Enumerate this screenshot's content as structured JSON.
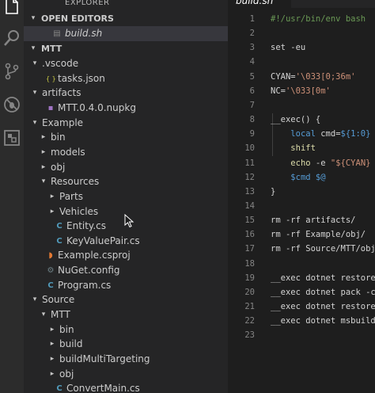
{
  "explorer": {
    "title": "EXPLORER",
    "open_editors_label": "OPEN EDITORS",
    "open_file": "build.sh",
    "root_label": "MTT",
    "tree": [
      {
        "label": ".vscode",
        "depth": 1,
        "open": true,
        "type": "folder"
      },
      {
        "label": "tasks.json",
        "depth": 2,
        "type": "json"
      },
      {
        "label": "artifacts",
        "depth": 1,
        "open": true,
        "type": "folder"
      },
      {
        "label": "MTT.0.4.0.nupkg",
        "depth": 2,
        "type": "file"
      },
      {
        "label": "Example",
        "depth": 1,
        "open": true,
        "type": "folder"
      },
      {
        "label": "bin",
        "depth": 2,
        "open": false,
        "type": "folder"
      },
      {
        "label": "models",
        "depth": 2,
        "open": false,
        "type": "folder"
      },
      {
        "label": "obj",
        "depth": 2,
        "open": false,
        "type": "folder"
      },
      {
        "label": "Resources",
        "depth": 2,
        "open": true,
        "type": "folder"
      },
      {
        "label": "Parts",
        "depth": 3,
        "open": false,
        "type": "folder"
      },
      {
        "label": "Vehicles",
        "depth": 3,
        "open": false,
        "type": "folder"
      },
      {
        "label": "Entity.cs",
        "depth": 3,
        "type": "cs"
      },
      {
        "label": "KeyValuePair.cs",
        "depth": 3,
        "type": "cs"
      },
      {
        "label": "Example.csproj",
        "depth": 2,
        "type": "rss"
      },
      {
        "label": "NuGet.config",
        "depth": 2,
        "type": "gear"
      },
      {
        "label": "Program.cs",
        "depth": 2,
        "type": "cs"
      },
      {
        "label": "Source",
        "depth": 1,
        "open": true,
        "type": "folder"
      },
      {
        "label": "MTT",
        "depth": 2,
        "open": true,
        "type": "folder"
      },
      {
        "label": "bin",
        "depth": 3,
        "open": false,
        "type": "folder"
      },
      {
        "label": "build",
        "depth": 3,
        "open": false,
        "type": "folder"
      },
      {
        "label": "buildMultiTargeting",
        "depth": 3,
        "open": false,
        "type": "folder"
      },
      {
        "label": "obj",
        "depth": 3,
        "open": false,
        "type": "folder"
      },
      {
        "label": "ConvertMain.cs",
        "depth": 3,
        "type": "cs"
      }
    ]
  },
  "editor": {
    "tab_label": "build.sh",
    "lines": [
      [
        {
          "t": "#!/usr/bin/env bash",
          "c": "#6a9955"
        }
      ],
      [],
      [
        {
          "t": "set -eu",
          "c": "#d4d4d4"
        }
      ],
      [],
      [
        {
          "t": "CYAN=",
          "c": "#d4d4d4"
        },
        {
          "t": "'\\033[0;36m'",
          "c": "#ce9178"
        }
      ],
      [
        {
          "t": "NC=",
          "c": "#d4d4d4"
        },
        {
          "t": "'\\033[0m'",
          "c": "#ce9178"
        }
      ],
      [],
      [
        {
          "t": "__exec() {",
          "c": "#d4d4d4"
        }
      ],
      [
        {
          "t": "    ",
          "c": "#d4d4d4"
        },
        {
          "t": "local",
          "c": "#569cd6"
        },
        {
          "t": " cmd=",
          "c": "#d4d4d4"
        },
        {
          "t": "${1:0}",
          "c": "#569cd6"
        }
      ],
      [
        {
          "t": "    ",
          "c": "#d4d4d4"
        },
        {
          "t": "shift",
          "c": "#dcdcaa"
        }
      ],
      [
        {
          "t": "    ",
          "c": "#d4d4d4"
        },
        {
          "t": "echo",
          "c": "#dcdcaa"
        },
        {
          "t": " -e ",
          "c": "#d4d4d4"
        },
        {
          "t": "\"${CYAN} >",
          "c": "#ce9178"
        }
      ],
      [
        {
          "t": "    ",
          "c": "#d4d4d4"
        },
        {
          "t": "$cmd $@",
          "c": "#569cd6"
        }
      ],
      [
        {
          "t": "}",
          "c": "#d4d4d4"
        }
      ],
      [],
      [
        {
          "t": "rm -rf artifacts/",
          "c": "#d4d4d4"
        }
      ],
      [
        {
          "t": "rm -rf Example/obj/",
          "c": "#d4d4d4"
        }
      ],
      [
        {
          "t": "rm -rf Source/MTT/obj/",
          "c": "#d4d4d4"
        }
      ],
      [],
      [
        {
          "t": "__exec dotnet restore",
          "c": "#d4d4d4"
        }
      ],
      [
        {
          "t": "__exec dotnet pack -c",
          "c": "#d4d4d4"
        }
      ],
      [
        {
          "t": "__exec dotnet restore",
          "c": "#d4d4d4"
        }
      ],
      [
        {
          "t": "__exec dotnet msbuild",
          "c": "#d4d4d4"
        }
      ],
      []
    ]
  },
  "colors": {
    "folder": "#c5c5c5",
    "json": "#cbcb41",
    "cs": "#519aba",
    "file": "#a074c4",
    "rss": "#e37933",
    "gear": "#6d8086"
  }
}
